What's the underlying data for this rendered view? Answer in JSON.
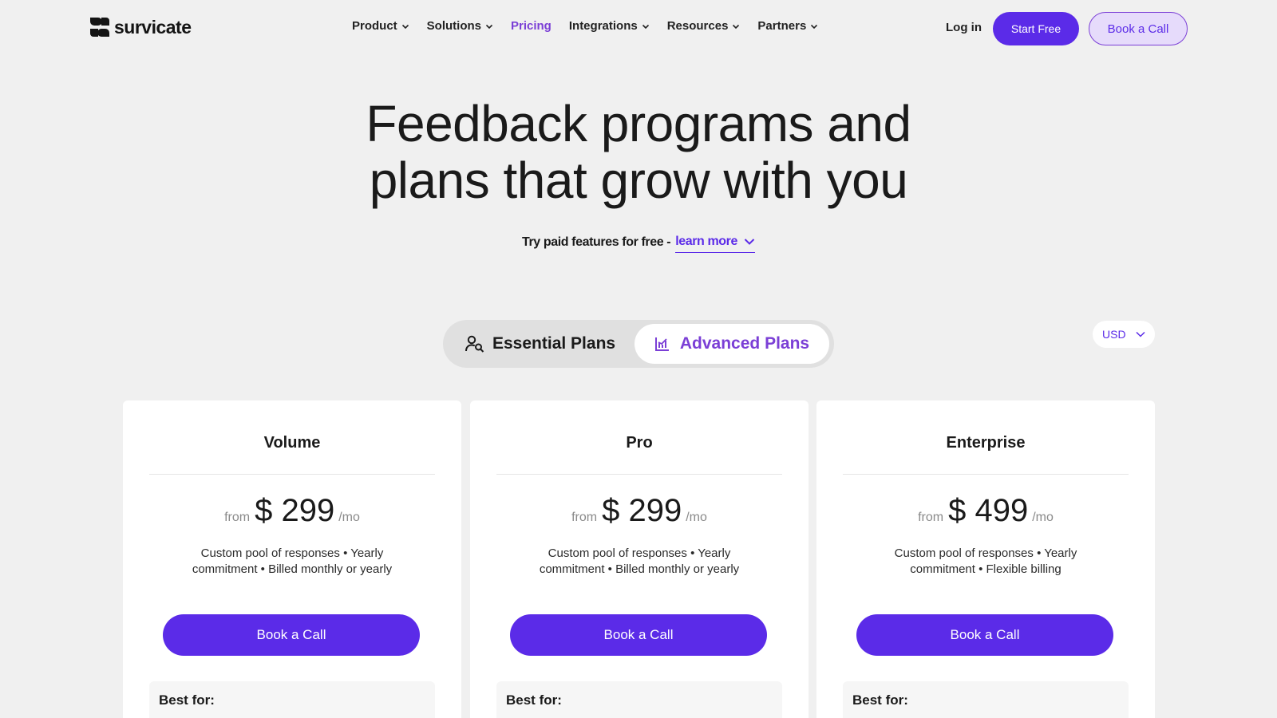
{
  "brand": {
    "name": "survicate"
  },
  "nav": {
    "items": [
      {
        "label": "Product",
        "dropdown": true
      },
      {
        "label": "Solutions",
        "dropdown": true
      },
      {
        "label": "Pricing",
        "dropdown": false,
        "active": true
      },
      {
        "label": "Integrations",
        "dropdown": true
      },
      {
        "label": "Resources",
        "dropdown": true
      },
      {
        "label": "Partners",
        "dropdown": true
      }
    ],
    "login": "Log in",
    "start_free": "Start Free",
    "book_call": "Book a Call"
  },
  "hero": {
    "title_line1": "Feedback programs and",
    "title_line2": "plans that grow with you",
    "sub_text": "Try paid features for free -",
    "learn_more": "learn more"
  },
  "toggle": {
    "essential": "Essential Plans",
    "advanced": "Advanced Plans",
    "selected": "advanced"
  },
  "currency": {
    "value": "USD"
  },
  "plans": [
    {
      "name": "Volume",
      "from": "from",
      "amount": "$ 299",
      "per": "/mo",
      "desc": "Custom pool of responses • Yearly commitment • Billed monthly or yearly",
      "cta": "Book a Call",
      "best_for": "Best for:"
    },
    {
      "name": "Pro",
      "from": "from",
      "amount": "$ 299",
      "per": "/mo",
      "desc": "Custom pool of responses • Yearly commitment • Billed monthly or yearly",
      "cta": "Book a Call",
      "best_for": "Best for:"
    },
    {
      "name": "Enterprise",
      "from": "from",
      "amount": "$ 499",
      "per": "/mo",
      "desc": "Custom pool of responses • Yearly commitment • Flexible billing",
      "cta": "Book a Call",
      "best_for": "Best for:"
    }
  ],
  "colors": {
    "accent": "#5b2be8",
    "accent_text": "#7b3fd6",
    "background": "#f0f0f0"
  }
}
